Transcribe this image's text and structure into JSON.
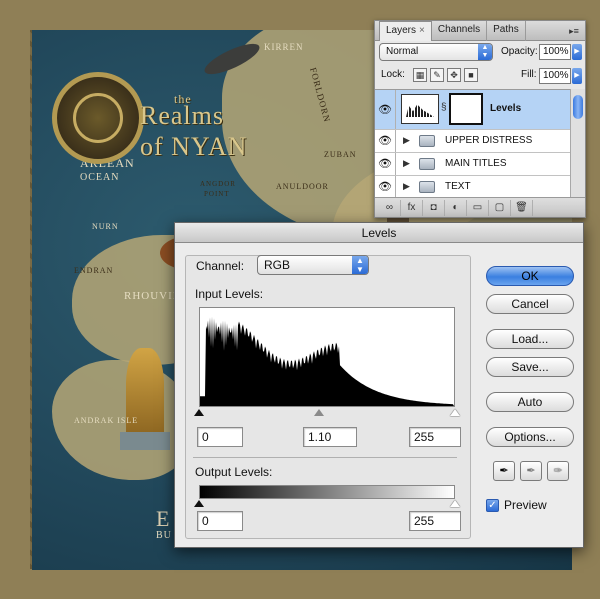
{
  "map": {
    "title_prefix": "the",
    "title_main": "Realms",
    "title_sub": "of NYAN",
    "labels": [
      "KIRREN",
      "FORLDORN",
      "ARLEAN",
      "OCEAN",
      "ANGDOR",
      "POINT",
      "ZUBAN",
      "ANULDOOR",
      "NURN",
      "ENDRAN",
      "RHOUVIL",
      "ANDRAK ISLE",
      "E",
      "BU"
    ]
  },
  "layers_panel": {
    "tabs": [
      "Layers",
      "Channels",
      "Paths"
    ],
    "tab_close": "×",
    "menu_icon": "panel-menu-icon",
    "blend_mode": "Normal",
    "opacity_label": "Opacity:",
    "opacity_value": "100%",
    "lock_label": "Lock:",
    "fill_label": "Fill:",
    "fill_value": "100%",
    "layers": [
      {
        "name": "Levels",
        "type": "adjustment",
        "selected": true
      },
      {
        "name": "UPPER DISTRESS",
        "type": "group"
      },
      {
        "name": "MAIN TITLES",
        "type": "group"
      },
      {
        "name": "TEXT",
        "type": "group"
      }
    ],
    "bottom_icons": [
      "link-icon",
      "fx-icon",
      "mask-icon",
      "adjustment-icon",
      "folder-icon",
      "new-layer-icon",
      "trash-icon"
    ],
    "bottom_glyphs": [
      "∞",
      "fx",
      "◘",
      "◐",
      "▭",
      "▢",
      "🗑"
    ]
  },
  "levels_dialog": {
    "title": "Levels",
    "channel_label": "Channel:",
    "channel_value": "RGB",
    "input_levels_label": "Input Levels:",
    "input_black": "0",
    "input_gamma": "1.10",
    "input_white": "255",
    "input_gamma_position": 0.47,
    "output_levels_label": "Output Levels:",
    "output_black": "0",
    "output_white": "255",
    "buttons": {
      "ok": "OK",
      "cancel": "Cancel",
      "load": "Load...",
      "save": "Save...",
      "auto": "Auto",
      "options": "Options..."
    },
    "preview_label": "Preview",
    "preview_checked": true,
    "eyedroppers": [
      "black-point-eyedropper-icon",
      "gray-point-eyedropper-icon",
      "white-point-eyedropper-icon"
    ]
  },
  "colors": {
    "accent": "#3a7fe0",
    "selection": "#b5d3f5"
  }
}
